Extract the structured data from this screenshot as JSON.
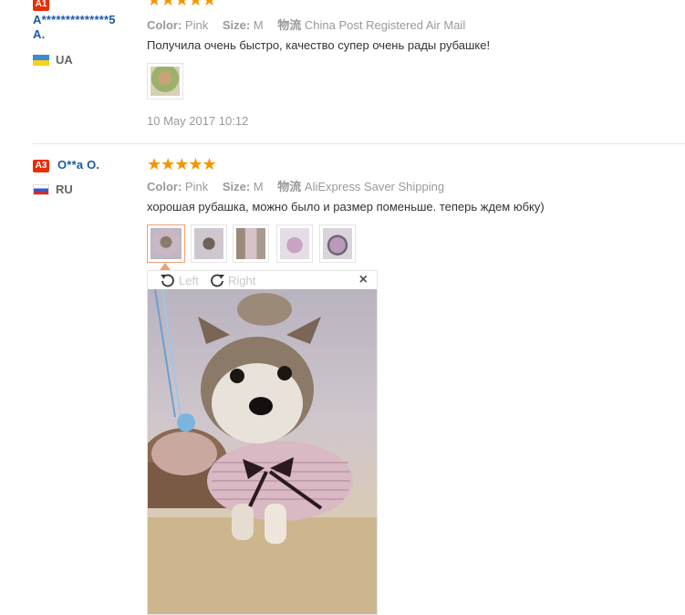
{
  "reviews": [
    {
      "level": "A1",
      "buyer": "A**************5 A.",
      "buyer_line1": "A**************5",
      "buyer_line2": "A.",
      "country": "UA",
      "color_label": "Color:",
      "color_value": "Pink",
      "size_label": "Size:",
      "size_value": "M",
      "logistics_label": "物流",
      "logistics_value": "China Post Registered Air Mail",
      "stars": "★★★★★",
      "rating": 5,
      "text": "Получила очень быстро, качество супер очень рады рубашке!",
      "date": "10 May 2017 10:12"
    },
    {
      "level": "A3",
      "buyer": "O**a O.",
      "country": "RU",
      "color_label": "Color:",
      "color_value": "Pink",
      "size_label": "Size:",
      "size_value": "M",
      "logistics_label": "物流",
      "logistics_value": "AliExpress Saver Shipping",
      "stars": "★★★★★",
      "rating": 5,
      "text": "хорошая рубашка, можно было и размер поменьше. теперь ждем юбку)"
    }
  ],
  "viewer": {
    "rotate_left": "Left",
    "rotate_right": "Right",
    "close": "×"
  },
  "colors": {
    "accent": "#e62e04",
    "star": "#f39400",
    "link": "#1a5aa6"
  }
}
